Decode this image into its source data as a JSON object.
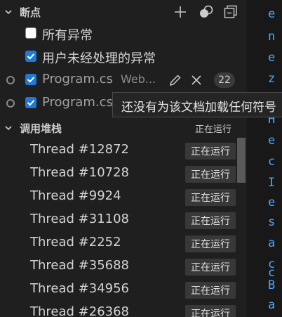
{
  "breakpoints": {
    "title": "断点",
    "items": [
      {
        "label": "所有异常",
        "checked": false
      },
      {
        "label": "用户未经处理的异常",
        "checked": true
      },
      {
        "label": "Program.cs",
        "description": "Web...",
        "count": "22",
        "checked": true
      },
      {
        "label": "Program.cs",
        "checked": true
      }
    ],
    "tooltip": "还没有为该文档加载任何符号"
  },
  "call_stack": {
    "title": "调用堆栈",
    "status": "正在运行",
    "threads": [
      {
        "name": "Thread #12872",
        "status": "正在运行"
      },
      {
        "name": "Thread #10728",
        "status": "正在运行"
      },
      {
        "name": "Thread #9924",
        "status": "正在运行"
      },
      {
        "name": "Thread #31108",
        "status": "正在运行"
      },
      {
        "name": "Thread #2252",
        "status": "正在运行"
      },
      {
        "name": "Thread #35688",
        "status": "正在运行"
      },
      {
        "name": "Thread #34956",
        "status": "正在运行"
      },
      {
        "name": "Thread #26368",
        "status": "正在运行"
      }
    ]
  },
  "editor_strip": [
    "e",
    "n",
    "e",
    "z",
    "H",
    "e",
    "c",
    "I",
    "e",
    "s",
    "a",
    "c",
    "c",
    "B",
    "a"
  ],
  "colors": {
    "accent": "#1e7ad6",
    "link": "#4fa6ff"
  },
  "icons": [
    "chevron-down-icon",
    "add-icon",
    "toggle-breakpoints-icon",
    "collapse-all-icon",
    "edit-icon",
    "close-icon"
  ]
}
